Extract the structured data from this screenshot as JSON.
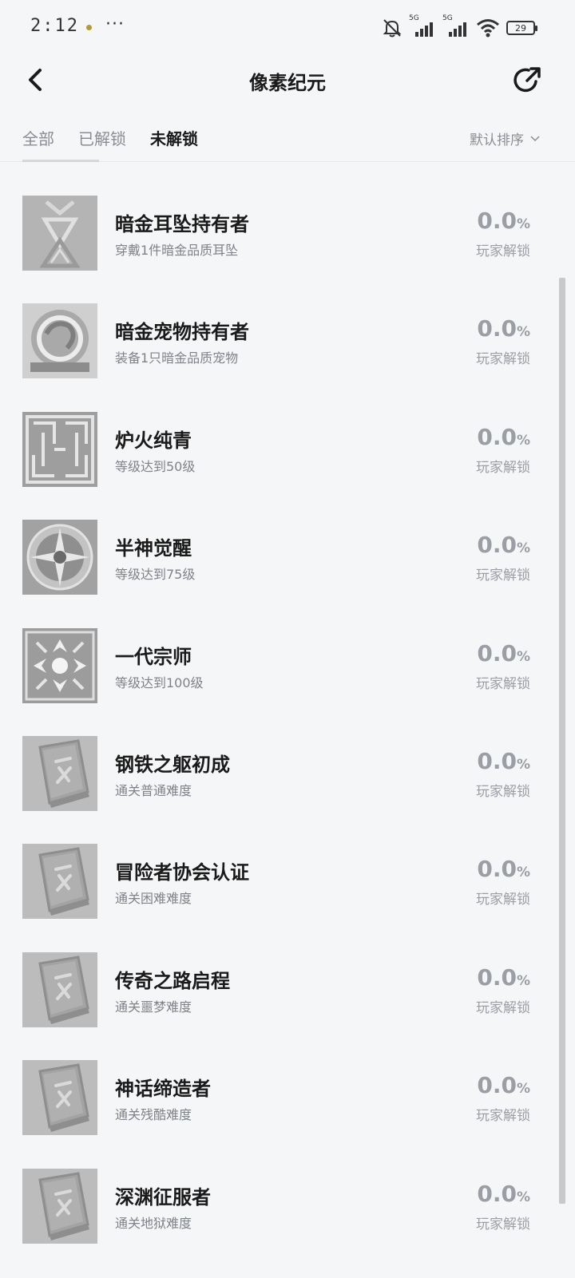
{
  "status_bar": {
    "time": "2:12",
    "more": "···",
    "network_1": "5G",
    "network_2": "5G",
    "battery": "29"
  },
  "header": {
    "title": "像素纪元"
  },
  "tabs": [
    {
      "label": "全部"
    },
    {
      "label": "已解锁"
    },
    {
      "label": "未解锁"
    }
  ],
  "sort_label": "默认排序",
  "unlock_label": "玩家解锁",
  "achievements": [
    {
      "title": "暗金耳坠持有者",
      "desc": "穿戴1件暗金品质耳坠",
      "pct": "0.0",
      "unit": "%",
      "icon": "earring-icon"
    },
    {
      "title": "暗金宠物持有者",
      "desc": "装备1只暗金品质宠物",
      "pct": "0.0",
      "unit": "%",
      "icon": "pet-icon"
    },
    {
      "title": "炉火纯青",
      "desc": "等级达到50级",
      "pct": "0.0",
      "unit": "%",
      "icon": "maze-icon"
    },
    {
      "title": "半神觉醒",
      "desc": "等级达到75级",
      "pct": "0.0",
      "unit": "%",
      "icon": "compass-icon"
    },
    {
      "title": "一代宗师",
      "desc": "等级达到100级",
      "pct": "0.0",
      "unit": "%",
      "icon": "pattern-icon"
    },
    {
      "title": "钢铁之躯初成",
      "desc": "通关普通难度",
      "pct": "0.0",
      "unit": "%",
      "icon": "rune-book-icon"
    },
    {
      "title": "冒险者协会认证",
      "desc": "通关困难难度",
      "pct": "0.0",
      "unit": "%",
      "icon": "rune-book-icon"
    },
    {
      "title": "传奇之路启程",
      "desc": "通关噩梦难度",
      "pct": "0.0",
      "unit": "%",
      "icon": "rune-book-icon"
    },
    {
      "title": "神话缔造者",
      "desc": "通关残酷难度",
      "pct": "0.0",
      "unit": "%",
      "icon": "rune-book-icon"
    },
    {
      "title": "深渊征服者",
      "desc": "通关地狱难度",
      "pct": "0.0",
      "unit": "%",
      "icon": "rune-book-icon"
    }
  ]
}
